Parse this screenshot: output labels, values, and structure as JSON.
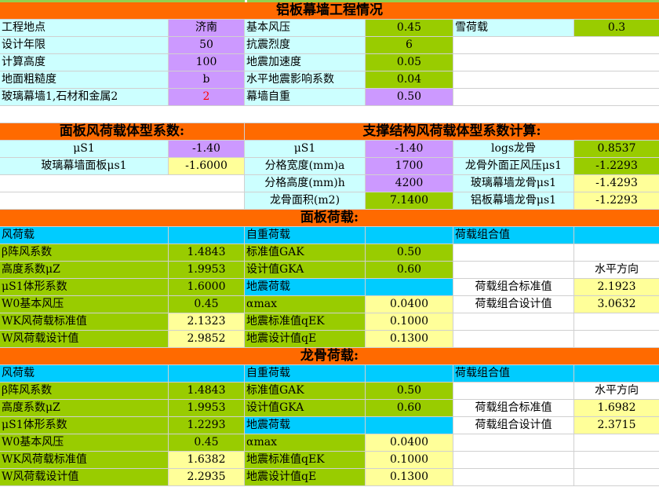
{
  "title": "铝板幕墙工程情况",
  "info": {
    "site_label": "工程地点",
    "site_value": "济南",
    "wind_label": "基本风压",
    "wind_value": "0.45",
    "snow_label": "雪荷载",
    "snow_value": "0.3",
    "years_label": "设计年限",
    "years_value": "50",
    "seismic_label": "抗震烈度",
    "seismic_value": "6",
    "height_label": "计算高度",
    "height_value": "100",
    "accel_label": "地震加速度",
    "accel_value": "0.05",
    "rough_label": "地面粗糙度",
    "rough_value": "b",
    "horiz_label": "水平地震影响系数",
    "horiz_value": "0.04",
    "type_label": "玻璃幕墙1,石材和金属2",
    "type_value": "2",
    "self_label": "幕墙自重",
    "self_value": "0.50"
  },
  "shape": {
    "panel_title": "面板风荷载体型系数:",
    "support_title": "支撑结构风荷载体型系数计算:",
    "r1": {
      "a": "μS1",
      "b": "-1.40",
      "c": "μS1",
      "d": "-1.40",
      "e": "logs龙骨",
      "f": "0.8537"
    },
    "r2": {
      "a": "玻璃幕墙面板μs1",
      "b": "-1.6000",
      "c": "分格宽度(mm)a",
      "d": "1700",
      "e": "龙骨外面正风压μs1",
      "f": "-1.2293"
    },
    "r3": {
      "c": "分格高度(mm)h",
      "d": "4200",
      "e": "玻璃幕墙龙骨μs1",
      "f": "-1.4293"
    },
    "r4": {
      "c": "龙骨面积(m2)",
      "d": "7.1400",
      "e": "铝板幕墙龙骨μs1",
      "f": "-1.2293"
    }
  },
  "panel": {
    "title": "面板荷载:",
    "h1": "风荷载",
    "h2": "自重荷载",
    "h3": "荷载组合值",
    "rows": [
      {
        "a": "β阵风系数",
        "b": "1.4843",
        "c": "标准值GAK",
        "d": "0.50",
        "e": "",
        "f": ""
      },
      {
        "a": "高度系数μZ",
        "b": "1.9953",
        "c": "设计值GKA",
        "d": "0.60",
        "e": "",
        "f": "水平方向"
      },
      {
        "a": "μS1体形系数",
        "b": "1.6000",
        "c": "地震荷载",
        "d": "",
        "e": "荷载组合标准值",
        "f": "2.1923"
      },
      {
        "a": "W0基本风压",
        "b": "0.45",
        "c": "αmax",
        "d": "0.0400",
        "e": "荷载组合设计值",
        "f": "3.0632"
      },
      {
        "a": "WK风荷载标准值",
        "b": "2.1323",
        "c": "地震标准值qEK",
        "d": "0.1000",
        "e": "",
        "f": ""
      },
      {
        "a": "W风荷载设计值",
        "b": "2.9852",
        "c": "地震设计值qE",
        "d": "0.1300",
        "e": "",
        "f": ""
      }
    ]
  },
  "frame": {
    "title": "龙骨荷载:",
    "h1": "风荷载",
    "h2": "自重荷载",
    "h3": "荷载组合值",
    "rows": [
      {
        "a": "β阵风系数",
        "b": "1.4843",
        "c": "标准值GAK",
        "d": "0.50",
        "e": "",
        "f": "水平方向"
      },
      {
        "a": "高度系数μZ",
        "b": "1.9953",
        "c": "设计值GKA",
        "d": "0.60",
        "e": "荷载组合标准值",
        "f": "1.6982"
      },
      {
        "a": "μS1体形系数",
        "b": "1.2293",
        "c": "地震荷载",
        "d": "",
        "e": "荷载组合设计值",
        "f": "2.3715"
      },
      {
        "a": "W0基本风压",
        "b": "0.45",
        "c": "αmax",
        "d": "0.0400",
        "e": "",
        "f": ""
      },
      {
        "a": "WK风荷载标准值",
        "b": "1.6382",
        "c": "地震标准值qEK",
        "d": "0.1000",
        "e": "",
        "f": ""
      },
      {
        "a": "W风荷载设计值",
        "b": "2.2935",
        "c": "地震设计值qE",
        "d": "0.1300",
        "e": "",
        "f": ""
      }
    ]
  },
  "colors": {
    "orange": "#ff6a00",
    "cyan": "#ccffff",
    "lavender": "#cc99ff",
    "green": "#99cc00",
    "yellow": "#ffff99",
    "blue": "#00ccff"
  }
}
